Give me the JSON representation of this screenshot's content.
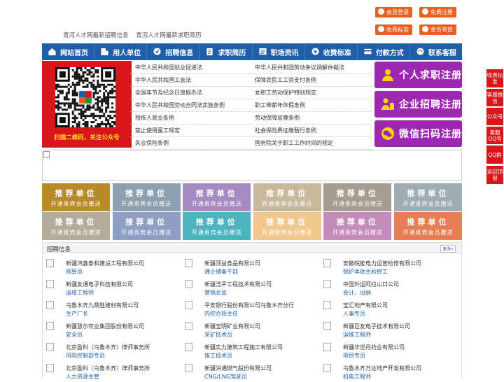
{
  "header": {
    "links": [
      "青河人才网最新招聘信息",
      "青河人才网最新求职简历"
    ],
    "buttons": {
      "member_login": "会员登录",
      "free_register": "免费注册",
      "fee_standard": "收费标准",
      "gold_recharge": "金币充值"
    }
  },
  "nav": {
    "items": [
      {
        "label": "网站首页",
        "icon": "home-icon"
      },
      {
        "label": "用人单位",
        "icon": "building-icon"
      },
      {
        "label": "招聘信息",
        "icon": "megaphone-icon"
      },
      {
        "label": "求职简历",
        "icon": "resume-icon"
      },
      {
        "label": "职场资讯",
        "icon": "news-icon"
      },
      {
        "label": "收费标准",
        "icon": "coin-icon"
      },
      {
        "label": "付款方式",
        "icon": "card-icon"
      },
      {
        "label": "联系客服",
        "icon": "headset-icon"
      }
    ]
  },
  "qr_panel": {
    "caption": "扫描二维码，关注公众号"
  },
  "laws": {
    "left": [
      "中华人民共和国就业促进法",
      "中华人民共和国工会法",
      "全国年节及纪念日放假办法",
      "中华人民共和国劳动合同法实施条例",
      "残疾人就业条例",
      "禁止使用童工规定",
      "失业保险条例"
    ],
    "right": [
      "中华人民共和国劳动争议调解仲裁法",
      "保障农民工工资支付条例",
      "女职工劳动保护特别规定",
      "职工带薪年休假条例",
      "劳动保障监察条例",
      "社会保险费征缴暂行条例",
      "国务院关于职工工作时间的规定"
    ]
  },
  "register": {
    "personal": "个人求职注册",
    "company": "企业招聘注册",
    "wechat": "微信扫码注册"
  },
  "recommend": {
    "title": "推荐单位",
    "subtitle": "开通贵宾会员赠送",
    "colors": [
      "#b88a2a",
      "#8ca0b0",
      "#a58bc2",
      "#c9b99c",
      "#a59d92",
      "#9eadb4",
      "#b5ab9a",
      "#8d9fc2",
      "#4eb3bc",
      "#f0c88e",
      "#c58bba",
      "#e67d54"
    ]
  },
  "jobs": {
    "title": "招聘信息",
    "more": "更多»",
    "items": [
      {
        "company": "新疆鸿鑫泰和建设工程有限公司",
        "position": "预算员"
      },
      {
        "company": "新疆顶益食品有限公司",
        "position": "通企储备干部"
      },
      {
        "company": "安徽皖能电力运营检修有限公司",
        "position": "锅炉本体主检修工"
      },
      {
        "company": "新疆友通电子科技有限公司",
        "position": "运维工程师"
      },
      {
        "company": "新疆浩平工程技术有限公司",
        "position": "营销总监"
      },
      {
        "company": "中国外运阿拉山口公司",
        "position": "会计、出纳"
      },
      {
        "company": "乌鲁木齐九鼎胜建材有限公司",
        "position": "生产厂长"
      },
      {
        "company": "平安银行股份有限公司乌鲁木齐分行",
        "position": "内控合规主任"
      },
      {
        "company": "宝汇地产有限公司",
        "position": "人事专员"
      },
      {
        "company": "新疆慧尔农业集团股份有限公司",
        "position": "安全员"
      },
      {
        "company": "新疆宝明矿业有限公司",
        "position": "采矿技术员"
      },
      {
        "company": "新疆巨友电子技术有限公司",
        "position": "运维工程师"
      },
      {
        "company": "北京盈科（乌鲁木齐）律师事务所",
        "position": "风险控制部专员"
      },
      {
        "company": "新疆实力建筑工程施工有限公司",
        "position": "施工技术员"
      },
      {
        "company": "新疆华世丹药业有限公司",
        "position": "项目专员"
      },
      {
        "company": "北京盈科（乌鲁木齐）律师事务所",
        "position": "人力资源主管"
      },
      {
        "company": "新疆洪通燃气股份有限公司",
        "position": "CNG/LNG驾驶员"
      },
      {
        "company": "乌鲁木齐万达地产开发有限公司",
        "position": "机电工程师"
      }
    ]
  },
  "float_bar": [
    "收费标准",
    "客服微信",
    "公众号",
    "客服QQ号",
    "QQ群",
    "返回顶部"
  ],
  "colors": {
    "nav_blue": "#1f5fa8",
    "brand_red": "#d7151b",
    "orange": "#e8601c",
    "register_purple": "#9c27b0",
    "qr_caption": "#ffe400"
  }
}
